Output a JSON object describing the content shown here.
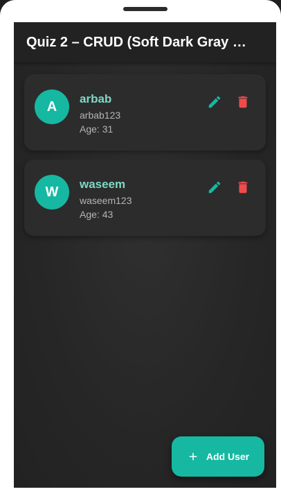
{
  "app": {
    "title": "Quiz 2 – CRUD (Soft Dark Gray …"
  },
  "users": [
    {
      "initial": "A",
      "name": "arbab",
      "username": "arbab123",
      "age_text": "Age: 31"
    },
    {
      "initial": "W",
      "name": "waseem",
      "username": "waseem123",
      "age_text": "Age: 43"
    }
  ],
  "fab": {
    "label": "Add User",
    "icon": "plus-icon"
  },
  "icons": {
    "edit": "edit-icon",
    "delete": "delete-icon"
  },
  "colors": {
    "accent": "#16b8a2",
    "delete": "#f04b4b",
    "name": "#7fd8c6",
    "background": "#262626",
    "card": "#2c2c2c"
  }
}
